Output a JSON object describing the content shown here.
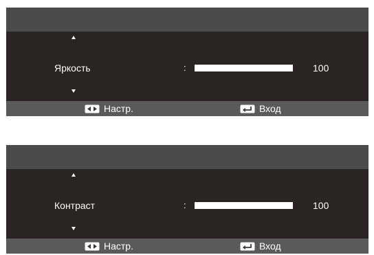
{
  "panels": [
    {
      "setting_label": "Яркость",
      "separator": ":",
      "level_percent": 100,
      "value_text": "100",
      "footer": {
        "adjust_label": "Настр.",
        "enter_label": "Вход"
      }
    },
    {
      "setting_label": "Контраст",
      "separator": ":",
      "level_percent": 100,
      "value_text": "100",
      "footer": {
        "adjust_label": "Настр.",
        "enter_label": "Вход"
      }
    }
  ],
  "colors": {
    "header_bg": "#4b4b4b",
    "body_bg": "#2a2522",
    "footer_bg": "#5a5a5a",
    "text": "#ffffff"
  },
  "icons": {
    "adjust": "left-right-arrows-key-icon",
    "enter": "enter-key-icon"
  }
}
